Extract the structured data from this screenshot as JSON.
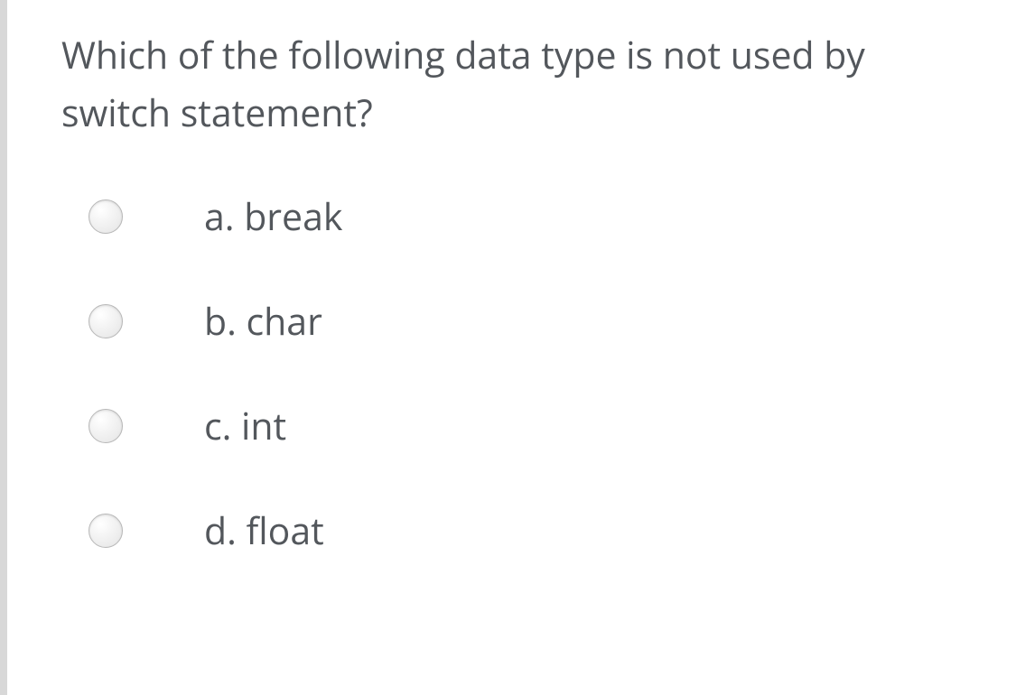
{
  "question": "Which of the following data type is not used by switch statement?",
  "options": [
    {
      "label": "a. break"
    },
    {
      "label": "b. char"
    },
    {
      "label": "c. int"
    },
    {
      "label": "d. float"
    }
  ]
}
